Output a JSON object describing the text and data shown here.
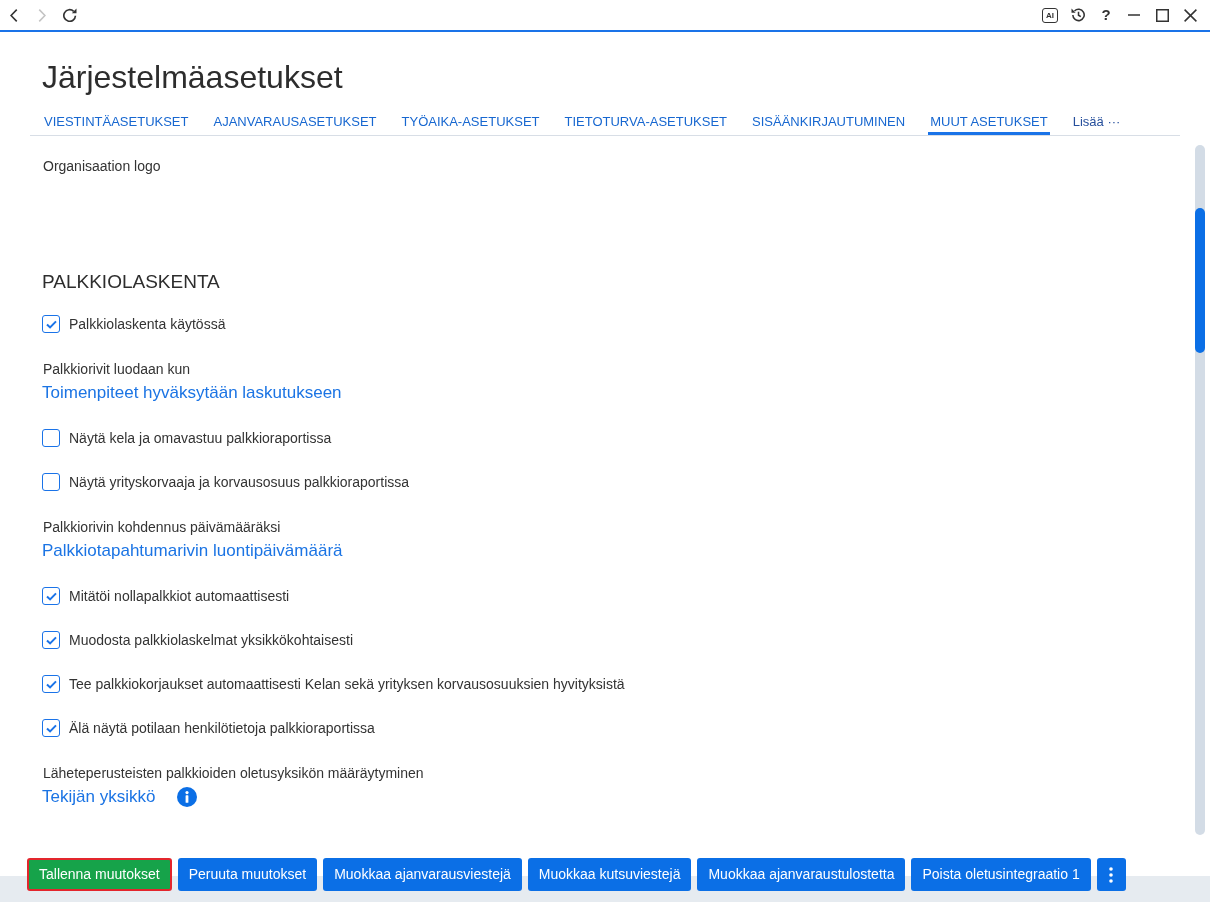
{
  "toolbar": {
    "nav": [
      {
        "kind": "back",
        "disabled": false
      },
      {
        "kind": "forward",
        "disabled": true
      },
      {
        "kind": "reload",
        "disabled": false
      }
    ],
    "controls": [
      {
        "kind": "ai",
        "label": "AI"
      },
      {
        "kind": "history"
      },
      {
        "kind": "help",
        "label": "?"
      },
      {
        "kind": "minimize"
      },
      {
        "kind": "maximize"
      },
      {
        "kind": "close"
      }
    ]
  },
  "page": {
    "title": "Järjestelmäasetukset"
  },
  "tabs": [
    {
      "kind": "tab",
      "label": "VIESTINTÄASETUKSET",
      "selected": false
    },
    {
      "kind": "tab",
      "label": "AJANVARAUSASETUKSET",
      "selected": false
    },
    {
      "kind": "tab",
      "label": "TYÖAIKA-ASETUKSET",
      "selected": false
    },
    {
      "kind": "tab",
      "label": "TIETOTURVA-ASETUKSET",
      "selected": false
    },
    {
      "kind": "tab",
      "label": "SISÄÄNKIRJAUTUMINEN",
      "selected": false
    },
    {
      "kind": "tab",
      "label": "MUUT ASETUKSET",
      "selected": true
    },
    {
      "kind": "more",
      "label": "Lisää ···",
      "selected": false
    }
  ],
  "content": {
    "logo_label": "Organisaation logo",
    "section_heading": "PALKKIOLASKENTA",
    "settings": [
      {
        "kind": "checkbox",
        "label": "Palkkiolaskenta käytössä",
        "checked": true
      },
      {
        "kind": "choice",
        "label": "Palkkiorivit luodaan kun",
        "value": "Toimenpiteet hyväksytään laskutukseen",
        "info": false
      },
      {
        "kind": "checkbox",
        "label": "Näytä kela ja omavastuu palkkioraportissa",
        "checked": false
      },
      {
        "kind": "checkbox",
        "label": "Näytä yrityskorvaaja ja korvausosuus palkkioraportissa",
        "checked": false
      },
      {
        "kind": "choice",
        "label": "Palkkiorivin kohdennus päivämääräksi",
        "value": "Palkkiotapahtumarivin luontipäivämäärä",
        "info": false
      },
      {
        "kind": "checkbox",
        "label": "Mitätöi nollapalkkiot automaattisesti",
        "checked": true
      },
      {
        "kind": "checkbox",
        "label": "Muodosta palkkiolaskelmat yksikkökohtaisesti",
        "checked": true
      },
      {
        "kind": "checkbox",
        "label": "Tee palkkiokorjaukset automaattisesti Kelan sekä yrityksen korvausosuuksien hyvityksistä",
        "checked": true
      },
      {
        "kind": "checkbox",
        "label": "Älä näytä potilaan henkilötietoja palkkioraportissa",
        "checked": true
      },
      {
        "kind": "choice",
        "label": "Läheteperusteisten palkkioiden oletusyksikön määräytyminen",
        "value": "Tekijän yksikkö",
        "info": true
      }
    ]
  },
  "actions": [
    {
      "kind": "save",
      "label": "Tallenna muutokset",
      "highlighted": true
    },
    {
      "kind": "text",
      "label": "Peruuta muutokset",
      "highlighted": false
    },
    {
      "kind": "text",
      "label": "Muokkaa ajanvarausviestejä",
      "highlighted": false
    },
    {
      "kind": "text",
      "label": "Muokkaa kutsuviestejä",
      "highlighted": false
    },
    {
      "kind": "text",
      "label": "Muokkaa ajanvaraustulostetta",
      "highlighted": false
    },
    {
      "kind": "text",
      "label": "Poista oletusintegraatio 1",
      "highlighted": false
    },
    {
      "kind": "menu",
      "highlighted": false
    }
  ]
}
